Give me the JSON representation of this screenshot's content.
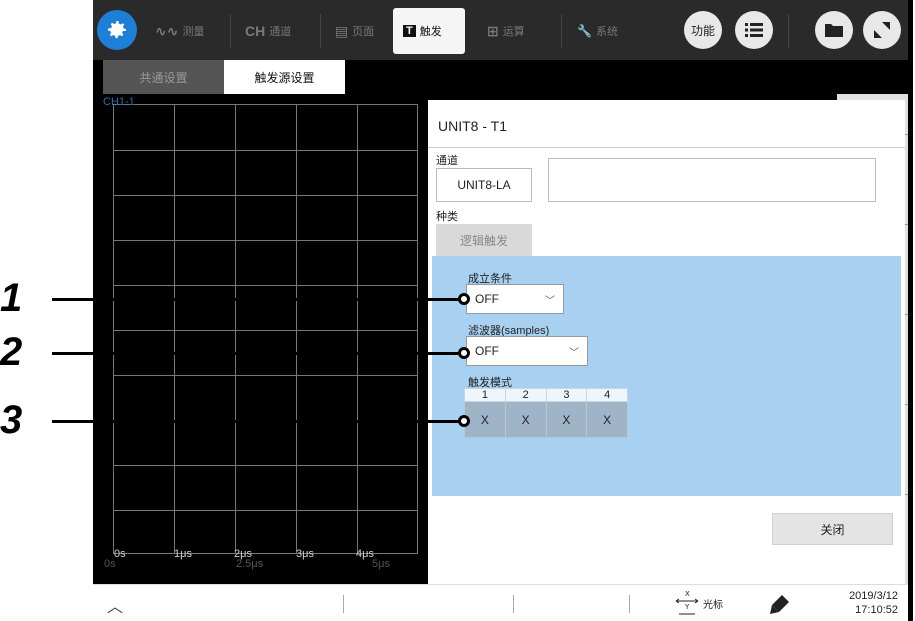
{
  "toolbar": {
    "tabs": [
      {
        "icon": "∿∿",
        "label": "测量"
      },
      {
        "icon": "CH",
        "label": "通道"
      },
      {
        "icon": "▤",
        "label": "页面"
      },
      {
        "icon": "T",
        "label": "触发"
      },
      {
        "icon": "⊞",
        "label": "运算"
      },
      {
        "icon": "🔧",
        "label": "系统"
      }
    ],
    "function_label": "功能"
  },
  "subtabs": {
    "common": "共通设置",
    "source": "触发源设置"
  },
  "waveform": {
    "channel_label": "CH1-1",
    "ticks": [
      "0s",
      "1μs",
      "2μs",
      "3μs",
      "4μs"
    ],
    "ticks_secondary": [
      "0s",
      "2.5μs",
      "5μs"
    ]
  },
  "dialog": {
    "title": "UNIT8 - T1",
    "channel_label": "通道",
    "channel_value": "UNIT8-LA",
    "type_label": "种类",
    "type_value": "逻辑触发",
    "condition_label": "成立条件",
    "condition_value": "OFF",
    "filter_label": "滤波器(samples)",
    "filter_value": "OFF",
    "mode_label": "触发模式",
    "mode_headers": [
      "1",
      "2",
      "3",
      "4"
    ],
    "mode_values": [
      "X",
      "X",
      "X",
      "X"
    ],
    "close_label": "关闭"
  },
  "statusbar": {
    "cursor_label": "光标",
    "date": "2019/3/12",
    "time": "17:10:52"
  },
  "callouts": [
    "1",
    "2",
    "3"
  ],
  "colors": {
    "accent": "#1e7fd6",
    "panel_blue": "#a8d0f0",
    "toolbar": "#2a2a2a"
  }
}
